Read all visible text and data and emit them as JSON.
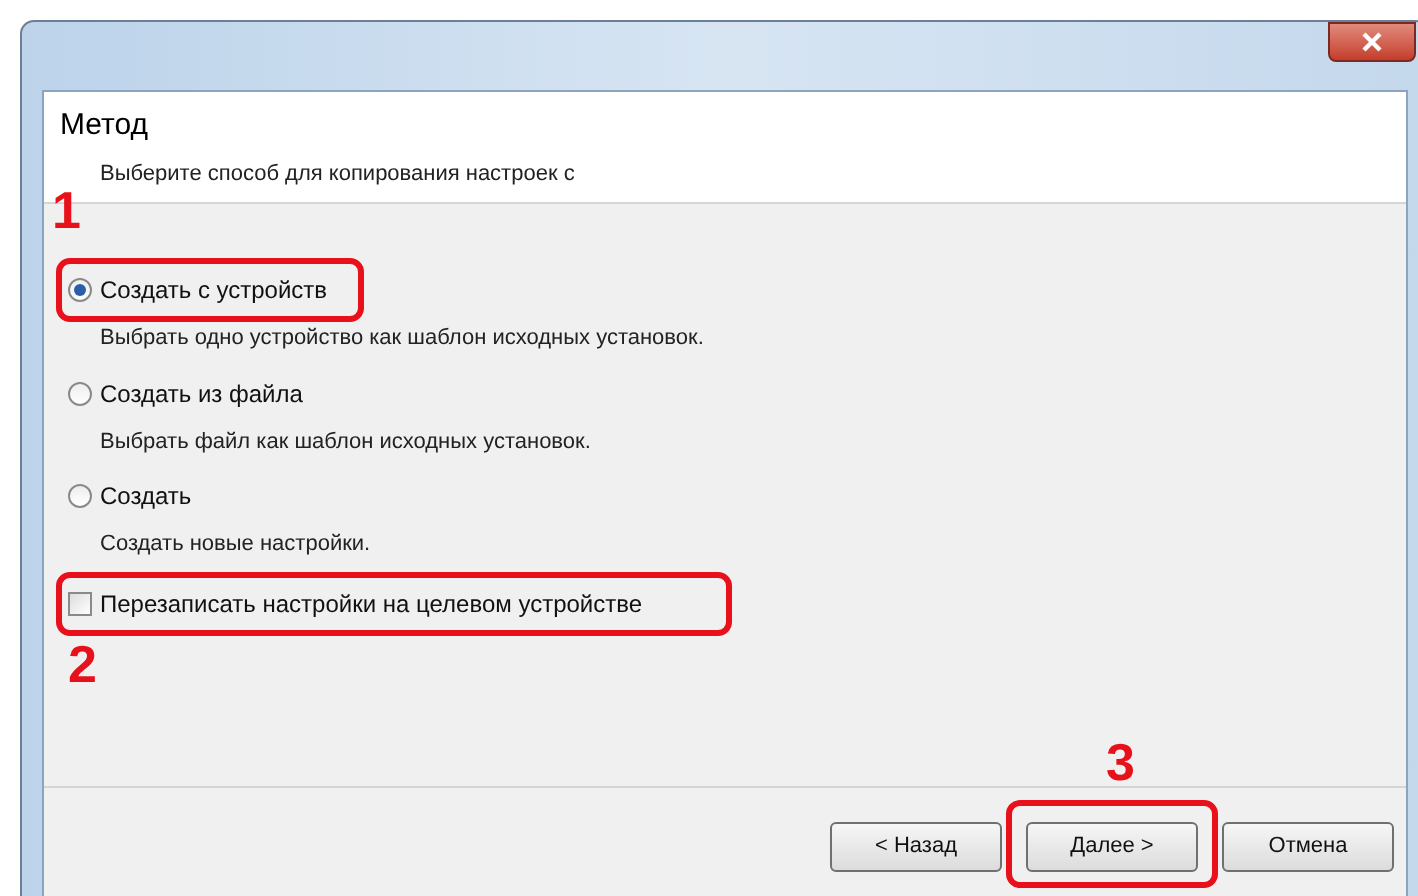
{
  "header": {
    "title": "Метод",
    "subtitle": "Выберите способ для копирования настроек с"
  },
  "options": [
    {
      "label": "Создать с устройств",
      "description": "Выбрать одно устройство как шаблон исходных установок.",
      "selected": true,
      "highlighted": true,
      "callout": "1"
    },
    {
      "label": "Создать из файла",
      "description": "Выбрать файл как шаблон исходных установок.",
      "selected": false,
      "highlighted": false
    },
    {
      "label": "Создать",
      "description": "Создать новые настройки.",
      "selected": false,
      "highlighted": false
    }
  ],
  "overwrite": {
    "label": "Перезаписать настройки на целевом устройстве",
    "checked": false,
    "highlighted": true,
    "callout": "2"
  },
  "buttons": [
    {
      "label": "< Назад",
      "highlighted": false
    },
    {
      "label": "Далее >",
      "highlighted": true,
      "callout": "3"
    },
    {
      "label": "Отмена",
      "highlighted": false
    }
  ]
}
